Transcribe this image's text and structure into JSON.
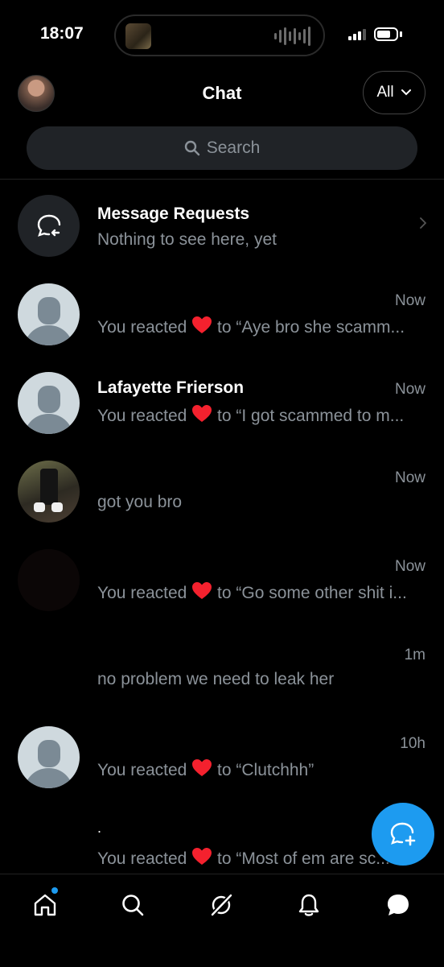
{
  "status_bar": {
    "time": "18:07"
  },
  "header": {
    "title": "Chat",
    "filter_label": "All"
  },
  "search": {
    "placeholder": "Search"
  },
  "message_requests": {
    "title": "Message Requests",
    "subtitle": "Nothing to see here, yet"
  },
  "conversations": [
    {
      "name": "",
      "time": "Now",
      "prefix": "You reacted",
      "suffix": "to “Aye bro she scamm...",
      "avatar": "default-avatar"
    },
    {
      "name": "Lafayette Frierson",
      "time": "Now",
      "prefix": "You reacted",
      "suffix": "to “I got scammed to m...",
      "avatar": "default-avatar"
    },
    {
      "name": "",
      "time": "Now",
      "preview": "got you bro",
      "avatar": "photo-avatar"
    },
    {
      "name": "",
      "time": "Now",
      "prefix": "You reacted",
      "suffix": "to “Go some other shit i...",
      "avatar": "dark-avatar"
    },
    {
      "name": "",
      "time": "1m",
      "preview": "no problem we need to leak her",
      "avatar": "none"
    },
    {
      "name": "",
      "time": "10h",
      "prefix": "You reacted",
      "suffix": "to “Clutchhh”",
      "avatar": "default-avatar"
    },
    {
      "name": ".",
      "time": "",
      "prefix": "You reacted",
      "suffix": "to “Most of em are sc...",
      "avatar": "none"
    }
  ],
  "tabs": [
    "home-icon",
    "search-icon",
    "grok-icon",
    "notifications-icon",
    "messages-icon"
  ],
  "colors": {
    "accent": "#1d9bf0",
    "heart": "#f4212e",
    "muted": "#8b9299"
  }
}
